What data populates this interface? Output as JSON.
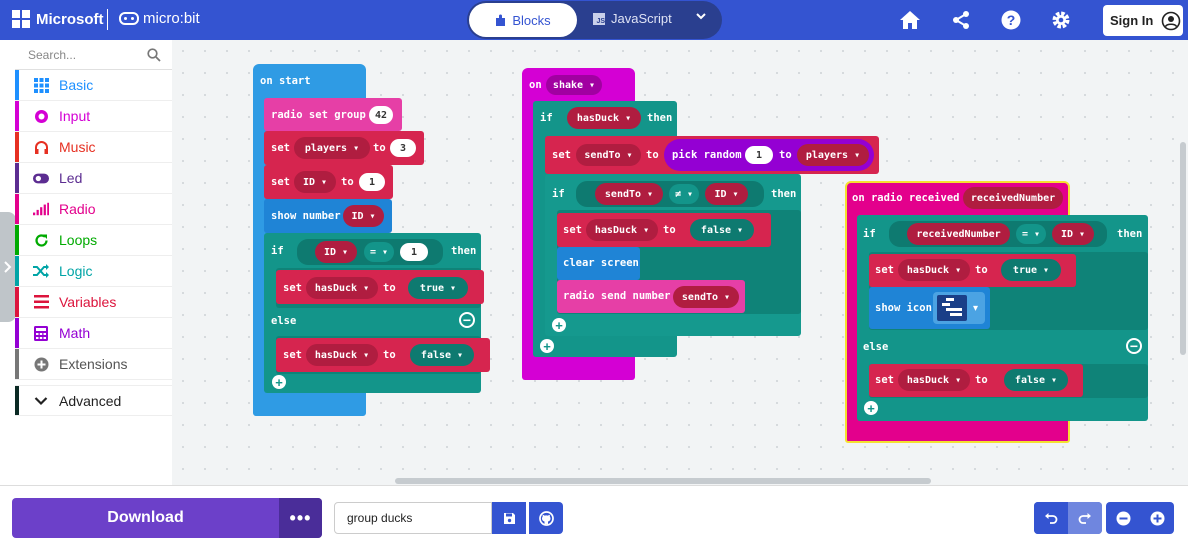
{
  "topbar": {
    "brand": "Microsoft",
    "product": "micro:bit",
    "editor_tabs": [
      {
        "label": "Blocks",
        "active": true
      },
      {
        "label": "JavaScript",
        "active": false
      }
    ],
    "js_icon_text": "JS",
    "sign_in": "Sign In",
    "icons": [
      "home-icon",
      "share-icon",
      "help-icon",
      "settings-icon"
    ]
  },
  "toolbox": {
    "search_placeholder": "Search...",
    "categories": [
      {
        "label": "Basic",
        "color": "#1e90ff",
        "icon": "grid-icon"
      },
      {
        "label": "Input",
        "color": "#d400d4",
        "icon": "target-icon"
      },
      {
        "label": "Music",
        "color": "#e63022",
        "icon": "headphones-icon"
      },
      {
        "label": "Led",
        "color": "#5c2d91",
        "icon": "toggle-icon"
      },
      {
        "label": "Radio",
        "color": "#e3008c",
        "icon": "signal-bars-icon"
      },
      {
        "label": "Loops",
        "color": "#00aa00",
        "icon": "refresh-icon"
      },
      {
        "label": "Logic",
        "color": "#00a4a6",
        "icon": "shuffle-icon"
      },
      {
        "label": "Variables",
        "color": "#dc143c",
        "icon": "lines-icon"
      },
      {
        "label": "Math",
        "color": "#9400d3",
        "icon": "calculator-icon"
      },
      {
        "label": "Extensions",
        "color": "#777777",
        "icon": "plus-circle-icon"
      }
    ],
    "advanced": "Advanced"
  },
  "blocks": {
    "on_start": {
      "hat": "on start",
      "radio_set_group": "radio set group",
      "group_value": "42",
      "set": "set",
      "to": "to",
      "var_players": "players",
      "players_value": "3",
      "var_id": "ID",
      "id_value": "1",
      "show_number": "show number",
      "show_number_var": "ID",
      "if": "if",
      "then": "then",
      "else": "else",
      "cond_left": "ID",
      "cond_op": "=",
      "cond_right": "1",
      "var_hasduck": "hasDuck",
      "true_value": "true",
      "false_value": "false"
    },
    "on_shake": {
      "hat": "on",
      "event": "shake",
      "if": "if",
      "cond_var": "hasDuck",
      "then": "then",
      "set": "set",
      "var_sendto": "sendTo",
      "to": "to",
      "pick_random": "pick random",
      "random_from": "1",
      "random_to_word": "to",
      "random_to_var": "players",
      "inner_if": "if",
      "cmp_left": "sendTo",
      "cmp_op": "≠",
      "cmp_right": "ID",
      "inner_then": "then",
      "set_hasduck": "set",
      "var_hasduck": "hasDuck",
      "set_to": "to",
      "false_value": "false",
      "clear_screen": "clear screen",
      "radio_send_number": "radio send number",
      "send_var": "sendTo"
    },
    "on_radio": {
      "hat": "on radio received",
      "param": "receivedNumber",
      "if": "if",
      "cond_left": "receivedNumber",
      "cond_op": "=",
      "cond_right": "ID",
      "then": "then",
      "set": "set",
      "var_hasduck": "hasDuck",
      "to": "to",
      "true_value": "true",
      "show_icon": "show icon",
      "else": "else",
      "false_value": "false"
    }
  },
  "bottombar": {
    "download": "Download",
    "more": "•••",
    "project_name": "group ducks"
  }
}
